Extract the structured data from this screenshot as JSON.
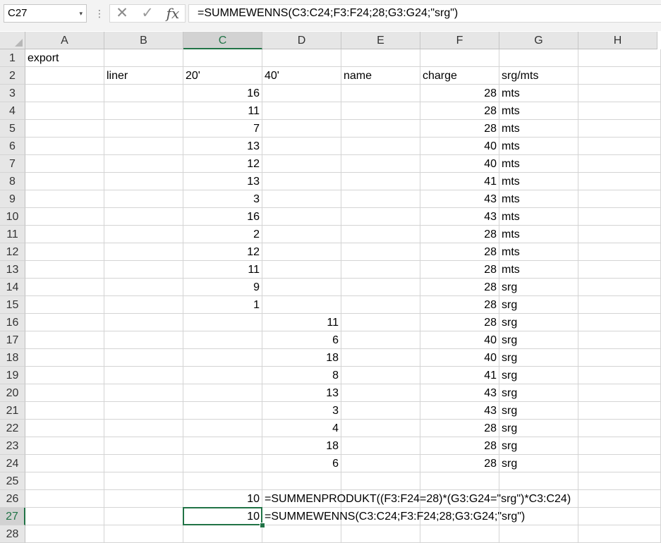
{
  "formula_bar": {
    "name_box": "C27",
    "dropdown_icon": "▾",
    "separator_icon": "⋮",
    "cancel_icon": "✕",
    "enter_icon": "✓",
    "fx_label": "fx",
    "formula": "=SUMMEWENNS(C3:C24;F3:F24;28;G3:G24;\"srg\")"
  },
  "columns": [
    "A",
    "B",
    "C",
    "D",
    "E",
    "F",
    "G",
    "H"
  ],
  "active_column": "C",
  "active_row": 27,
  "rows": [
    {
      "n": 1,
      "cells": {
        "A": "export"
      }
    },
    {
      "n": 2,
      "cells": {
        "B": "liner",
        "C": "20'",
        "D": "40'",
        "E": "name",
        "F": "charge",
        "G": "srg/mts"
      }
    },
    {
      "n": 3,
      "cells": {
        "C": "16",
        "F": "28",
        "G": "mts"
      }
    },
    {
      "n": 4,
      "cells": {
        "C": "11",
        "F": "28",
        "G": "mts"
      }
    },
    {
      "n": 5,
      "cells": {
        "C": "7",
        "F": "28",
        "G": "mts"
      }
    },
    {
      "n": 6,
      "cells": {
        "C": "13",
        "F": "40",
        "G": "mts"
      }
    },
    {
      "n": 7,
      "cells": {
        "C": "12",
        "F": "40",
        "G": "mts"
      }
    },
    {
      "n": 8,
      "cells": {
        "C": "13",
        "F": "41",
        "G": "mts"
      }
    },
    {
      "n": 9,
      "cells": {
        "C": "3",
        "F": "43",
        "G": "mts"
      }
    },
    {
      "n": 10,
      "cells": {
        "C": "16",
        "F": "43",
        "G": "mts"
      }
    },
    {
      "n": 11,
      "cells": {
        "C": "2",
        "F": "28",
        "G": "mts"
      }
    },
    {
      "n": 12,
      "cells": {
        "C": "12",
        "F": "28",
        "G": "mts"
      }
    },
    {
      "n": 13,
      "cells": {
        "C": "11",
        "F": "28",
        "G": "mts"
      }
    },
    {
      "n": 14,
      "cells": {
        "C": "9",
        "F": "28",
        "G": "srg"
      }
    },
    {
      "n": 15,
      "cells": {
        "C": "1",
        "F": "28",
        "G": "srg"
      }
    },
    {
      "n": 16,
      "cells": {
        "D": "11",
        "F": "28",
        "G": "srg"
      }
    },
    {
      "n": 17,
      "cells": {
        "D": "6",
        "F": "40",
        "G": "srg"
      }
    },
    {
      "n": 18,
      "cells": {
        "D": "18",
        "F": "40",
        "G": "srg"
      }
    },
    {
      "n": 19,
      "cells": {
        "D": "8",
        "F": "41",
        "G": "srg"
      }
    },
    {
      "n": 20,
      "cells": {
        "D": "13",
        "F": "43",
        "G": "srg"
      }
    },
    {
      "n": 21,
      "cells": {
        "D": "3",
        "F": "43",
        "G": "srg"
      }
    },
    {
      "n": 22,
      "cells": {
        "D": "4",
        "F": "28",
        "G": "srg"
      }
    },
    {
      "n": 23,
      "cells": {
        "D": "18",
        "F": "28",
        "G": "srg"
      }
    },
    {
      "n": 24,
      "cells": {
        "D": "6",
        "F": "28",
        "G": "srg"
      }
    },
    {
      "n": 25,
      "cells": {}
    },
    {
      "n": 26,
      "cells": {
        "C": "10",
        "D": "=SUMMENPRODUKT((F3:F24=28)*(G3:G24=\"srg\")*C3:C24)"
      }
    },
    {
      "n": 27,
      "cells": {
        "C": "10",
        "D": "=SUMMEWENNS(C3:C24;F3:F24;28;G3:G24;\"srg\")"
      }
    },
    {
      "n": 28,
      "cells": {}
    }
  ]
}
